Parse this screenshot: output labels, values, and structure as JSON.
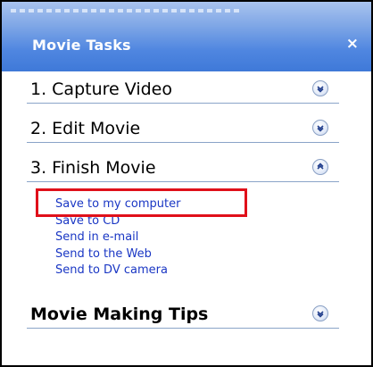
{
  "window": {
    "title": "Movie Tasks",
    "close_glyph": "×"
  },
  "sections": [
    {
      "label": "1. Capture Video",
      "state": "collapsed",
      "icon": "chevron-down-icon"
    },
    {
      "label": "2. Edit Movie",
      "state": "collapsed",
      "icon": "chevron-down-icon"
    },
    {
      "label": "3. Finish Movie",
      "state": "expanded",
      "icon": "chevron-up-icon"
    },
    {
      "label": "Movie Making Tips",
      "state": "collapsed",
      "icon": "chevron-down-icon"
    }
  ],
  "finish_tasks": [
    "Save to my computer",
    "Save to CD",
    "Send in e-mail",
    "Send to the Web",
    "Send to DV camera"
  ],
  "colors": {
    "title_bar": "#4f86e0",
    "task_link": "#1a37c4",
    "highlight_border": "#e0101a",
    "section_rule": "#8aa4c8"
  }
}
